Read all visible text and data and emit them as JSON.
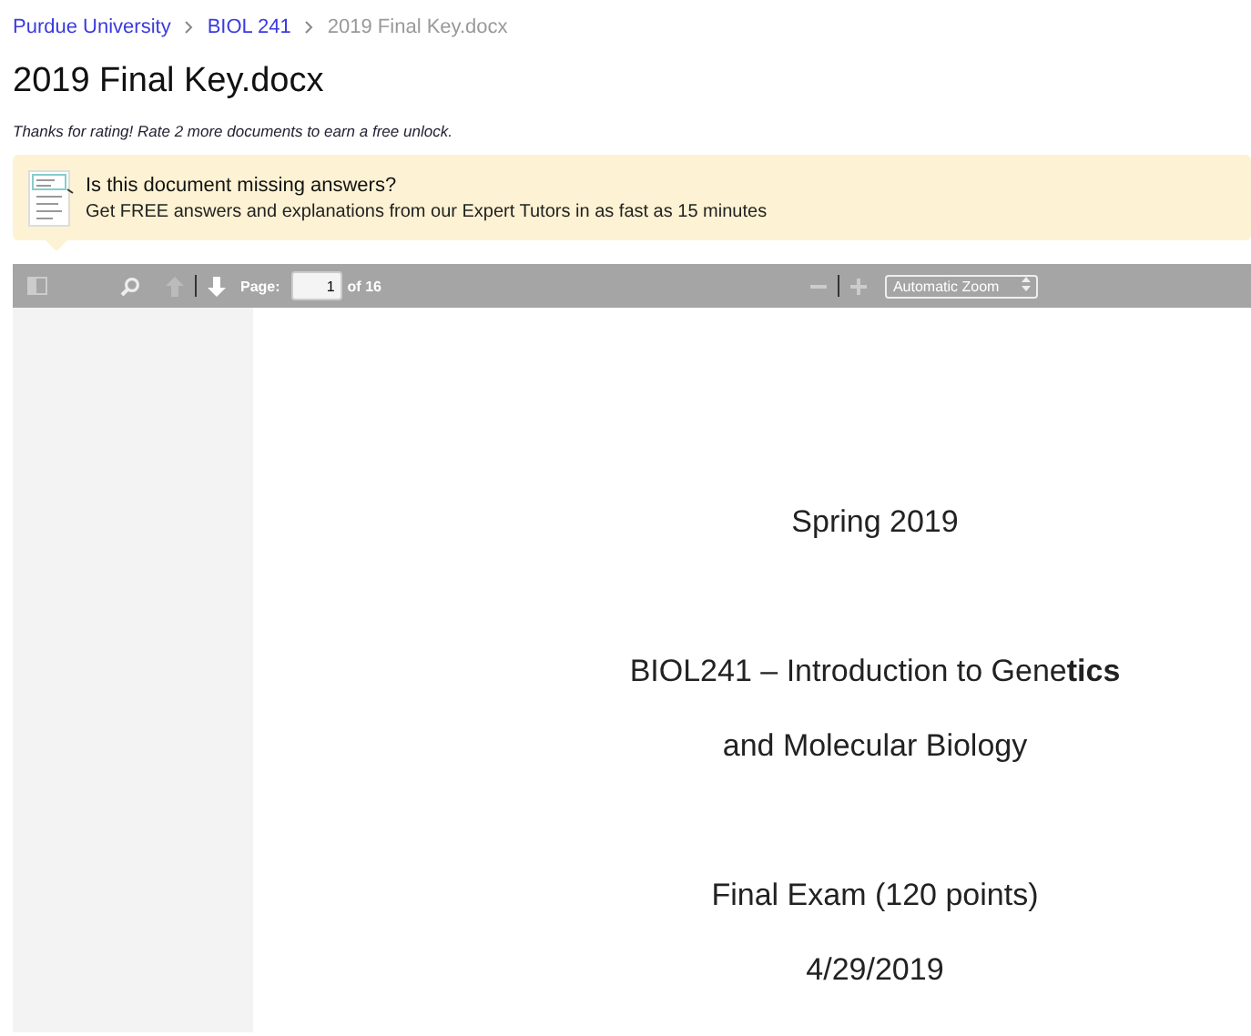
{
  "breadcrumbs": [
    {
      "label": "Purdue University",
      "link": true
    },
    {
      "label": "BIOL 241",
      "link": true
    },
    {
      "label": "2019 Final Key.docx",
      "link": false
    }
  ],
  "title": "2019 Final Key.docx",
  "rating_note": "Thanks for rating! Rate 2 more documents to earn a free unlock.",
  "banner": {
    "heading": "Is this document missing answers?",
    "text": "Get FREE answers and explanations from our Expert Tutors in as fast as 15 minutes"
  },
  "viewer": {
    "page_label": "Page:",
    "page_value": "1",
    "page_count": "of 16",
    "zoom": "Automatic Zoom"
  },
  "document_lines": [
    "Spring 2019",
    "BIOL241 – Introduction to Gene**tics**",
    "and Molecular Biology",
    "Final Exam (120 points)",
    "4/29/2019"
  ]
}
